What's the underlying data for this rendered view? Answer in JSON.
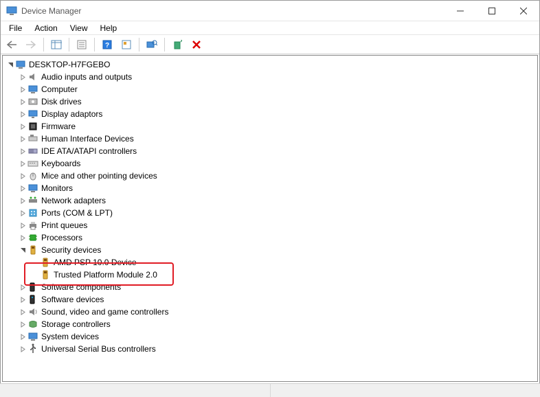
{
  "window": {
    "title": "Device Manager"
  },
  "menu": {
    "file": "File",
    "action": "Action",
    "view": "View",
    "help": "Help"
  },
  "toolbar_icons": {
    "back": "back-arrow",
    "forward": "forward-arrow",
    "show_hide": "show-hide-console-tree",
    "properties": "properties",
    "help": "help",
    "action_icon": "action",
    "scan": "scan-for-hardware-changes",
    "add_legacy": "add-legacy-hardware",
    "remove": "remove-device"
  },
  "tree": {
    "root": {
      "label": "DESKTOP-H7FGEBO",
      "icon": "computer-icon",
      "expanded": true
    },
    "categories": [
      {
        "label": "Audio inputs and outputs",
        "icon": "audio-icon",
        "expanded": false
      },
      {
        "label": "Computer",
        "icon": "computer-icon",
        "expanded": false
      },
      {
        "label": "Disk drives",
        "icon": "disk-icon",
        "expanded": false
      },
      {
        "label": "Display adaptors",
        "icon": "display-icon",
        "expanded": false
      },
      {
        "label": "Firmware",
        "icon": "firmware-icon",
        "expanded": false
      },
      {
        "label": "Human Interface Devices",
        "icon": "hid-icon",
        "expanded": false
      },
      {
        "label": "IDE ATA/ATAPI controllers",
        "icon": "ide-icon",
        "expanded": false
      },
      {
        "label": "Keyboards",
        "icon": "keyboard-icon",
        "expanded": false
      },
      {
        "label": "Mice and other pointing devices",
        "icon": "mouse-icon",
        "expanded": false
      },
      {
        "label": "Monitors",
        "icon": "monitor-icon",
        "expanded": false
      },
      {
        "label": "Network adapters",
        "icon": "network-icon",
        "expanded": false
      },
      {
        "label": "Ports (COM & LPT)",
        "icon": "ports-icon",
        "expanded": false
      },
      {
        "label": "Print queues",
        "icon": "printer-icon",
        "expanded": false
      },
      {
        "label": "Processors",
        "icon": "processor-icon",
        "expanded": false
      },
      {
        "label": "Security devices",
        "icon": "security-icon",
        "expanded": true,
        "children": [
          {
            "label": "AMD PSP 10.0 Device",
            "icon": "security-icon"
          },
          {
            "label": "Trusted Platform Module 2.0",
            "icon": "security-icon",
            "highlighted": true
          }
        ]
      },
      {
        "label": "Software components",
        "icon": "software-comp-icon",
        "expanded": false
      },
      {
        "label": "Software devices",
        "icon": "software-dev-icon",
        "expanded": false
      },
      {
        "label": "Sound, video and game controllers",
        "icon": "sound-icon",
        "expanded": false
      },
      {
        "label": "Storage controllers",
        "icon": "storage-icon",
        "expanded": false
      },
      {
        "label": "System devices",
        "icon": "system-icon",
        "expanded": false
      },
      {
        "label": "Universal Serial Bus controllers",
        "icon": "usb-icon",
        "expanded": false
      }
    ]
  }
}
